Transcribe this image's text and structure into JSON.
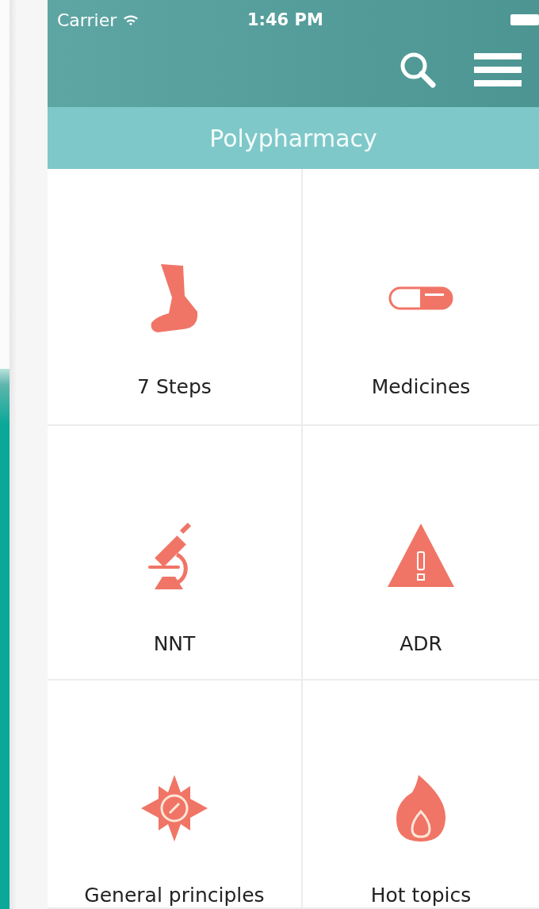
{
  "status_bar": {
    "carrier": "Carrier",
    "time": "1:46 PM"
  },
  "title": "Polypharmacy",
  "tiles": [
    {
      "label": "7 Steps"
    },
    {
      "label": "Medicines"
    },
    {
      "label": "NNT"
    },
    {
      "label": "ADR"
    },
    {
      "label": "General principles"
    },
    {
      "label": "Hot topics"
    }
  ]
}
